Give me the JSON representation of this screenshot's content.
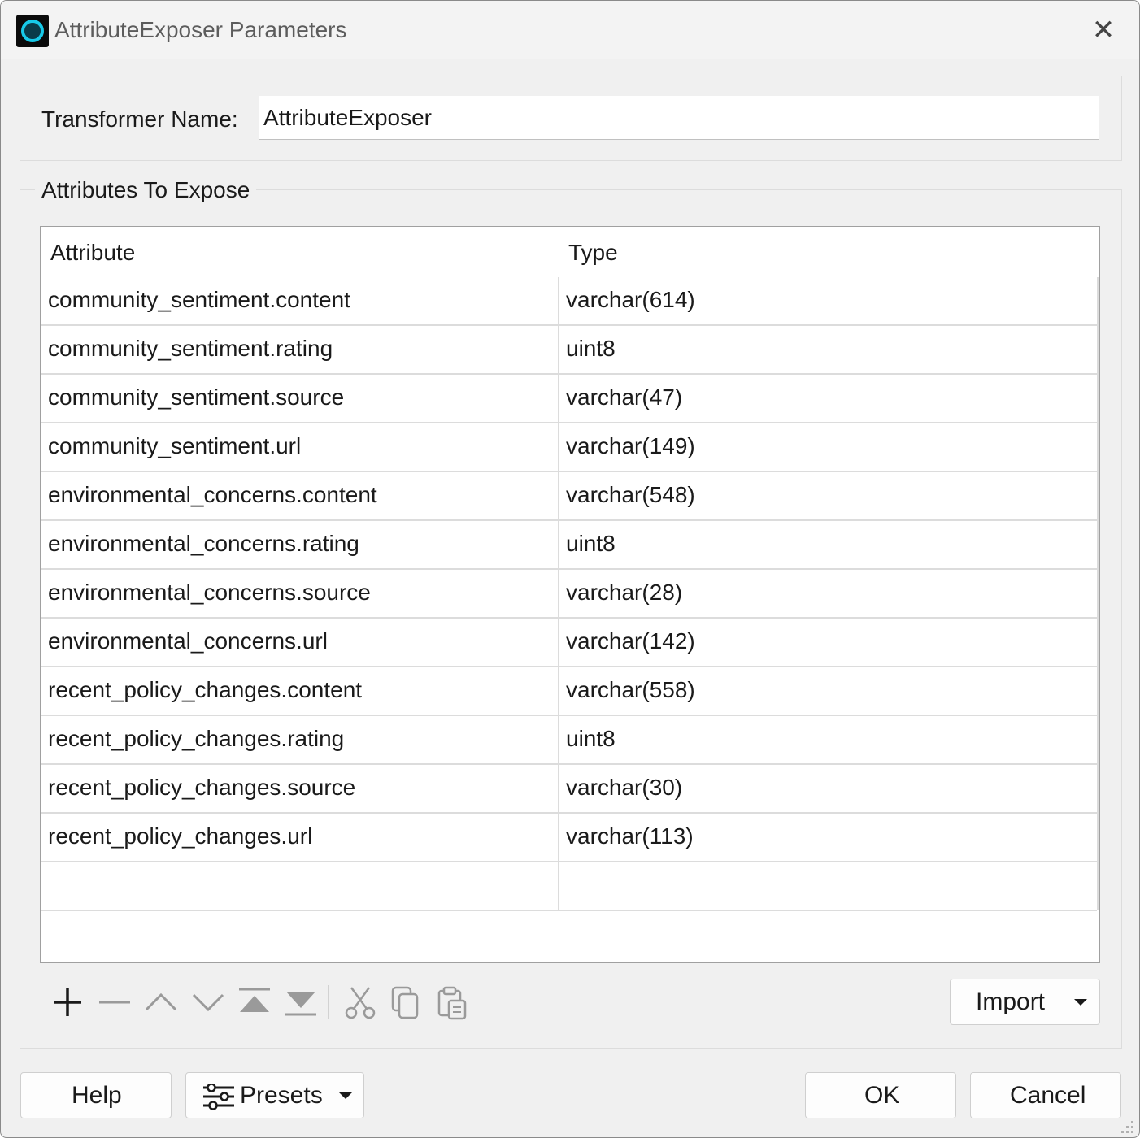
{
  "window": {
    "title": "AttributeExposer Parameters",
    "close_glyph": "✕"
  },
  "transformer": {
    "label": "Transformer Name:",
    "value": "AttributeExposer"
  },
  "attributes_group": {
    "title": "Attributes To Expose",
    "columns": [
      "Attribute",
      "Type"
    ],
    "rows": [
      {
        "attribute": "community_sentiment.content",
        "type": "varchar(614)"
      },
      {
        "attribute": "community_sentiment.rating",
        "type": "uint8"
      },
      {
        "attribute": "community_sentiment.source",
        "type": "varchar(47)"
      },
      {
        "attribute": "community_sentiment.url",
        "type": "varchar(149)"
      },
      {
        "attribute": "environmental_concerns.content",
        "type": "varchar(548)"
      },
      {
        "attribute": "environmental_concerns.rating",
        "type": "uint8"
      },
      {
        "attribute": "environmental_concerns.source",
        "type": "varchar(28)"
      },
      {
        "attribute": "environmental_concerns.url",
        "type": "varchar(142)"
      },
      {
        "attribute": "recent_policy_changes.content",
        "type": "varchar(558)"
      },
      {
        "attribute": "recent_policy_changes.rating",
        "type": "uint8"
      },
      {
        "attribute": "recent_policy_changes.source",
        "type": "varchar(30)"
      },
      {
        "attribute": "recent_policy_changes.url",
        "type": "varchar(113)"
      },
      {
        "attribute": "",
        "type": ""
      }
    ]
  },
  "toolbar": {
    "icons": [
      "add-icon",
      "remove-icon",
      "move-up-icon",
      "move-down-icon",
      "move-to-top-icon",
      "move-to-bottom-icon",
      "cut-icon",
      "copy-icon",
      "paste-icon"
    ],
    "import_label": "Import"
  },
  "footer": {
    "help_label": "Help",
    "presets_label": "Presets",
    "ok_label": "OK",
    "cancel_label": "Cancel"
  },
  "colors": {
    "dialog_bg": "#f0f0f0",
    "title_text": "#5c5c5c",
    "icon_ring": "#17c9e8",
    "icon_gray": "#9a9a9a",
    "icon_dark": "#1a1a1a"
  }
}
